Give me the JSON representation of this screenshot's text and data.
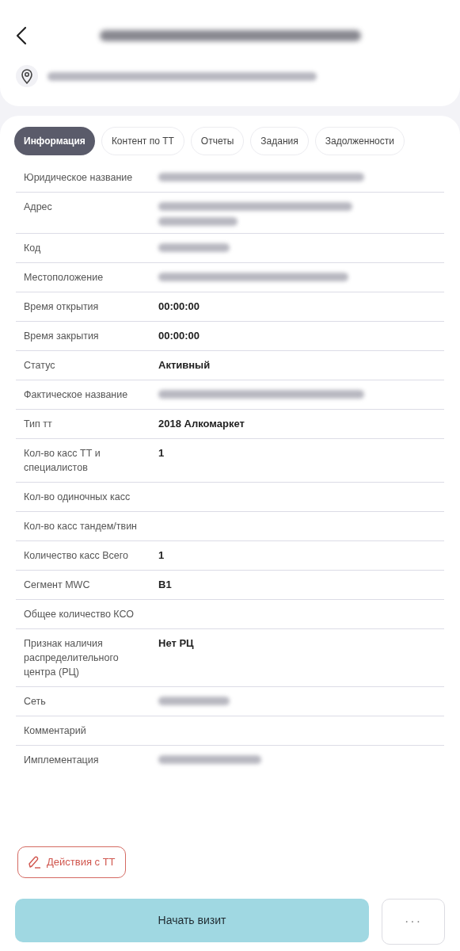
{
  "header": {
    "title_blurred": true,
    "address_blurred": true
  },
  "tabs": [
    {
      "label": "Информация",
      "selected": true
    },
    {
      "label": "Контент по ТТ",
      "selected": false
    },
    {
      "label": "Отчеты",
      "selected": false
    },
    {
      "label": "Задания",
      "selected": false
    },
    {
      "label": "Задолженности",
      "selected": false
    }
  ],
  "rows": [
    {
      "label": "Юридическое название",
      "blurred": true
    },
    {
      "label": "Адрес",
      "blurred": true
    },
    {
      "label": "Код",
      "blurred": true
    },
    {
      "label": "Местоположение",
      "blurred": true
    },
    {
      "label": "Время открытия",
      "value": "00:00:00"
    },
    {
      "label": "Время закрытия",
      "value": "00:00:00"
    },
    {
      "label": "Статус",
      "value": "Активный"
    },
    {
      "label": "Фактическое название",
      "blurred": true
    },
    {
      "label": "Тип тт",
      "value": "2018 Алкомаркет"
    },
    {
      "label": "Кол-во касс ТТ и специалистов",
      "value": "1"
    },
    {
      "label": "Кол-во одиночных касс"
    },
    {
      "label": "Кол-во касс тандем/твин"
    },
    {
      "label": "Количество касс Всего",
      "value": "1"
    },
    {
      "label": "Сегмент MWC",
      "value": "B1"
    },
    {
      "label": "Общее количество КСО"
    },
    {
      "label": "Признак наличия распределительного центра (РЦ)",
      "value": "Нет РЦ"
    },
    {
      "label": "Сеть",
      "blurred": true
    },
    {
      "label": "Комментарий"
    },
    {
      "label": "Имплементация",
      "blurred": true
    }
  ],
  "actions_button": "Действия с ТТ",
  "start_button": "Начать визит",
  "more_button": "···"
}
